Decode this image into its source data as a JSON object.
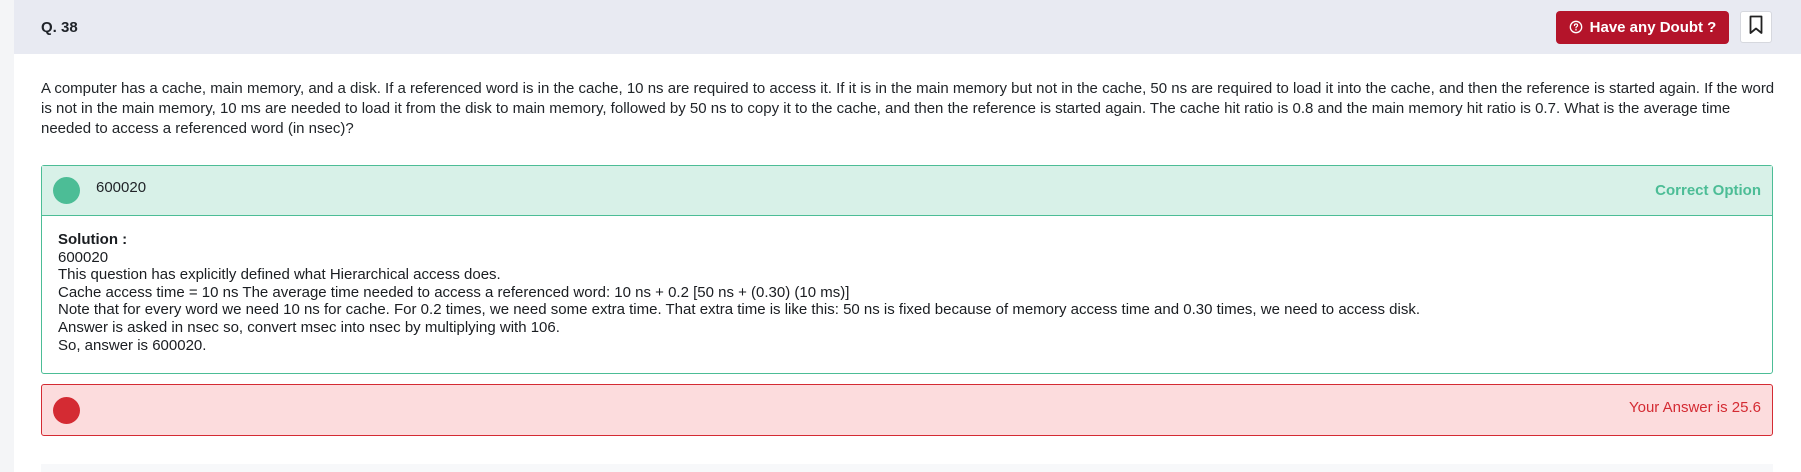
{
  "header": {
    "question_number": "Q. 38",
    "doubt_button_label": "Have any Doubt ?",
    "bookmark_icon": "bookmark-icon",
    "doubt_icon": "question-bubble-icon"
  },
  "question": {
    "text": "A computer has a cache, main memory, and a disk. If a referenced word is in the cache, 10 ns are required to access it. If it is in the main memory but not in the cache, 50 ns are required to load it into the cache, and then the reference is started again. If the word is not in the main memory, 10 ms are needed to load it from the disk to main memory, followed by 50 ns to copy it to the cache, and then the reference is started again. The cache hit ratio is 0.8 and the main memory hit ratio is 0.7. What is the average time needed to access a referenced word (in nsec)?"
  },
  "correct_option": {
    "value": "600020",
    "label": "Correct Option",
    "color": "#4cbd96"
  },
  "solution": {
    "title": "Solution :",
    "lines": [
      "600020",
      "This question has explicitly defined what Hierarchical access does.",
      "Cache access time = 10 ns The average time needed to access a referenced word: 10 ns + 0.2 [50 ns + (0.30) (10 ms)]",
      "Note that for every word we need 10 ns for cache. For 0.2 times, we need some extra time. That extra time is like this: 50 ns is fixed because of memory access time and 0.30 times, we need to access disk.",
      "Answer is asked in nsec so, convert msec into nsec by multiplying with 106.",
      "So, answer is 600020."
    ]
  },
  "user_answer": {
    "label": "Your Answer is 25.6",
    "color": "#d42b33"
  },
  "colors": {
    "header_bg": "#e8eaf2",
    "doubt_button_bg": "#b4142a",
    "correct_bg": "#d8f1e8",
    "wrong_bg": "#fcdcdd"
  }
}
